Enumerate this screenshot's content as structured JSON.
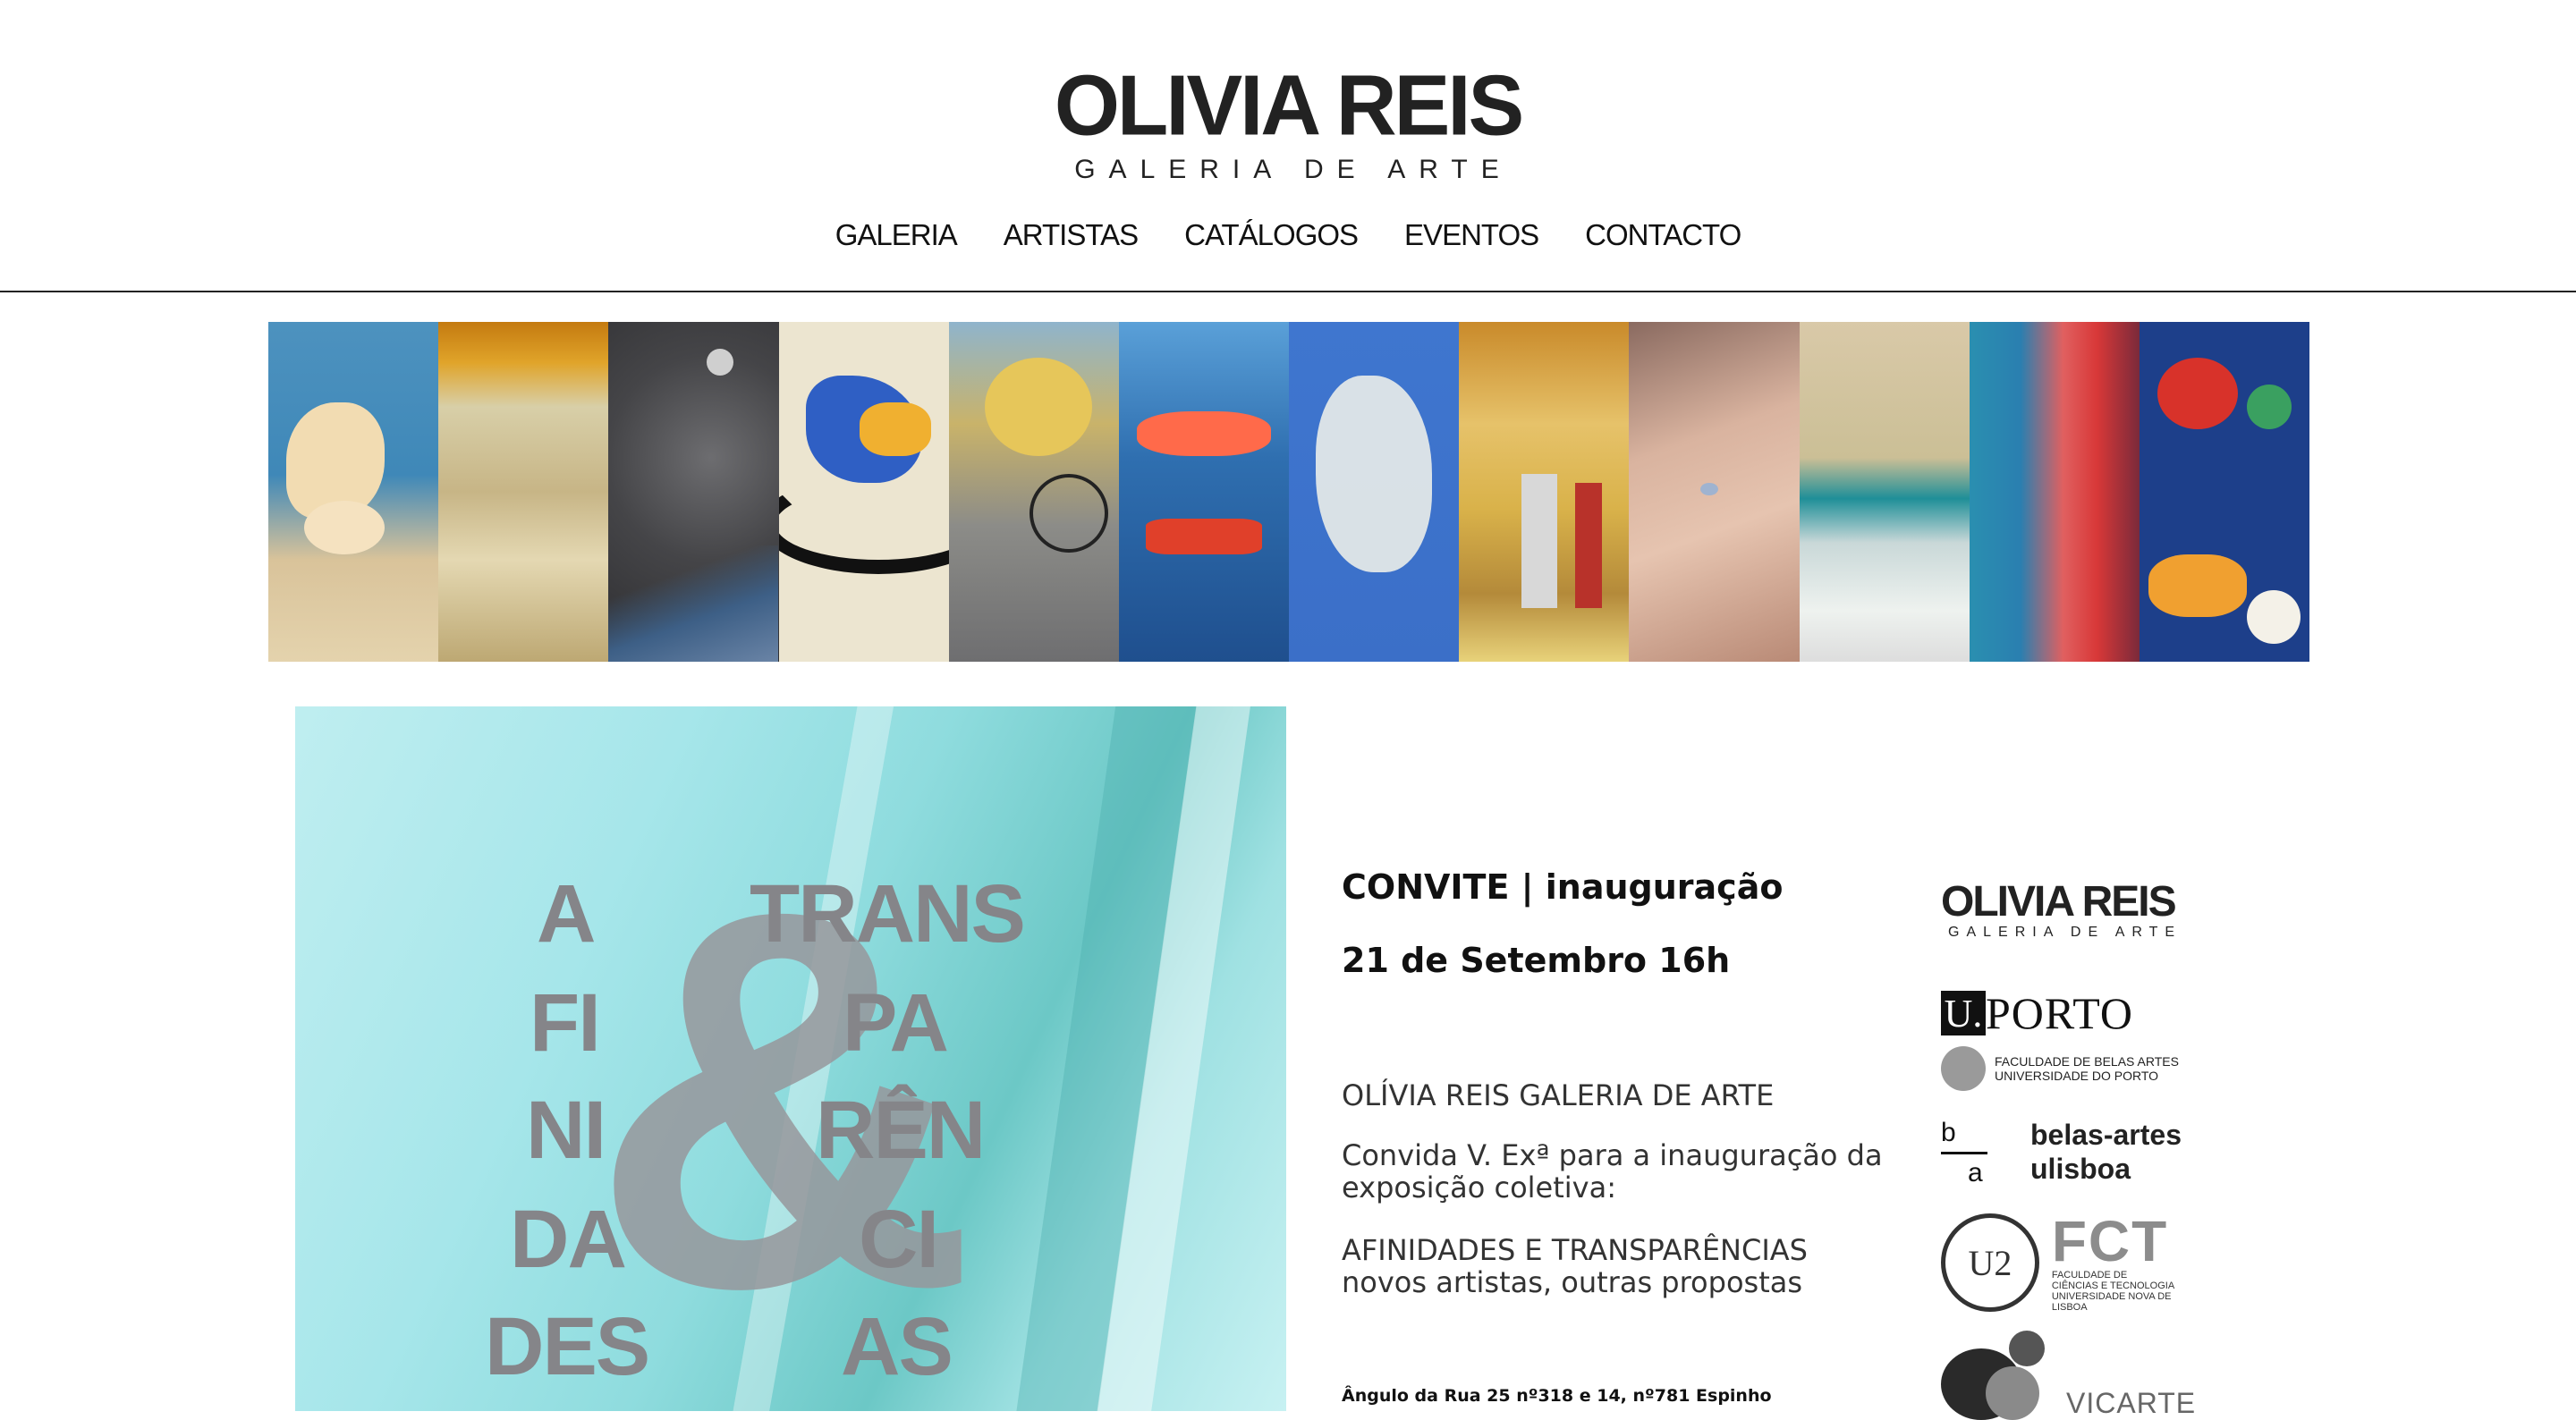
{
  "header": {
    "logo_name": "OLIVIA REIS",
    "logo_subtitle": "GALERIA DE ARTE"
  },
  "nav": {
    "items": [
      "GALERIA",
      "ARTISTAS",
      "CATÁLOGOS",
      "EVENTOS",
      "CONTACTO"
    ]
  },
  "artworks": {
    "count": 12,
    "dominant_colors": [
      "#3f88b8",
      "#c8a850",
      "#4a4a4e",
      "#e8e2d0",
      "#c9b36a",
      "#2f6fb0",
      "#3b6fc8",
      "#d9b24a",
      "#c59a86",
      "#b9c7be",
      "#2a8fb0",
      "#1d3f8a"
    ]
  },
  "poster": {
    "ampersand": "&",
    "left_words": [
      "A",
      "FI",
      "NI",
      "DA",
      "DES"
    ],
    "right_words": [
      "TRANS",
      "PA",
      "RÊN",
      "CI",
      "AS"
    ]
  },
  "invitation": {
    "title": "CONVITE | inauguração",
    "date": "21 de Setembro 16h",
    "gallery": "OLÍVIA REIS GALERIA DE ARTE",
    "invite_text": "Convida V. Exª para a inauguração da exposição coletiva:",
    "exhibition_title": "AFINIDADES E TRANSPARÊNCIAS",
    "exhibition_subtitle": "novos artistas, outras propostas",
    "address": "Ângulo da Rua 25 nº318 e 14, nº781 Espinho"
  },
  "partners": {
    "olivia_name": "OLIVIA REIS",
    "olivia_sub": "GALERIA DE ARTE",
    "uporto_u": "U.",
    "uporto_text": "PORTO",
    "fba_line1": "FACULDADE DE BELAS ARTES",
    "fba_line2": "UNIVERSIDADE DO PORTO",
    "ba_b": "b",
    "ba_a": "a",
    "ba_line1": "belas-artes",
    "ba_line2": "ulisboa",
    "fct_big": "FCT",
    "fct_line1": "FACULDADE DE",
    "fct_line2": "CIÊNCIAS E TECNOLOGIA",
    "fct_line3": "UNIVERSIDADE NOVA DE LISBOA",
    "vicarte": "VICARTE"
  }
}
